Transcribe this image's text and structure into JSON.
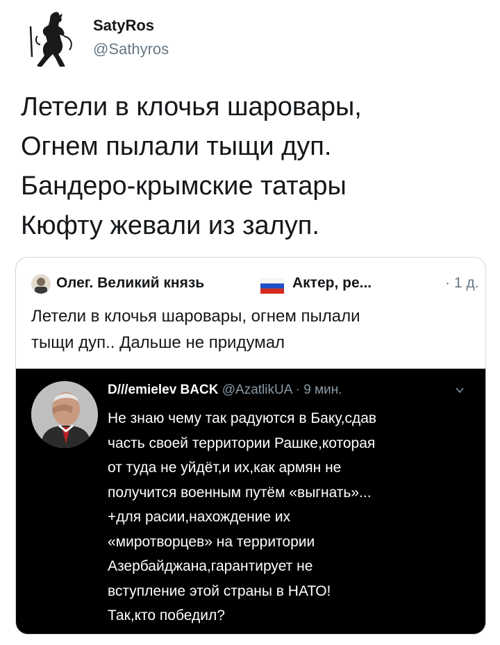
{
  "tweet": {
    "author_name": "SatyRos",
    "author_handle": "@Sathyros",
    "text_lines": [
      "Летели в клочья шаровары,",
      "Огнем пылали тыщи дуп.",
      "Бандеро-крымские татары",
      "Кюфту жевали из залуп."
    ]
  },
  "quote": {
    "author_name": "Олег. Великий князь",
    "author_name_suffix": "Актер, ре...",
    "flag_icon": "russia-flag-icon",
    "time": "· 1 д.",
    "text_lines": [
      "Летели в клочья шаровары, огнем пылали",
      "тыщи дуп.. Дальше не придумал"
    ]
  },
  "embedded": {
    "author_name": "D///emielev BACK",
    "author_meta": "@AzatlikUA · 9 мин.",
    "text_lines": [
      "Не знаю чему так радуются в Баку,сдав",
      "часть своей территории Рашке,которая",
      "от туда не уйдёт,и их,как армян не",
      "получится военным путём «выгнать»...",
      "+для расии,нахождение их",
      "«миротворцев» на территории",
      "Азербайджана,гарантирует не",
      "вступление этой страны в НАТО!",
      "Так,кто победил?"
    ]
  },
  "colors": {
    "text": "#14171a",
    "secondary": "#657786",
    "border": "#ccd6dd",
    "dark_bg": "#000000"
  }
}
